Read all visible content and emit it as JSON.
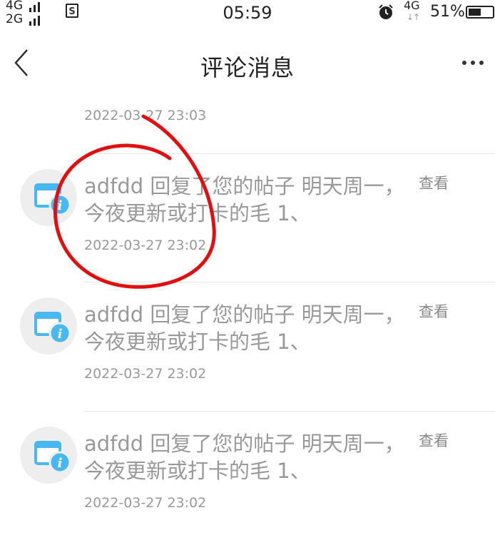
{
  "status_bar": {
    "sig1": "4G",
    "sig2": "2G",
    "time": "05:59",
    "net": "4G",
    "battery": "51%"
  },
  "nav": {
    "title": "评论消息"
  },
  "top_date": "2022-03-27 23:03",
  "messages": [
    {
      "text": "adfdd 回复了您的帖子 明天周一，今夜更新或打卡的毛 1、",
      "time": "2022-03-27 23:02",
      "action": "查看"
    },
    {
      "text": "adfdd 回复了您的帖子 明天周一，今夜更新或打卡的毛 1、",
      "time": "2022-03-27 23:02",
      "action": "查看"
    },
    {
      "text": "adfdd 回复了您的帖子 明天周一，今夜更新或打卡的毛 1、",
      "time": "2022-03-27 23:02",
      "action": "查看"
    }
  ],
  "colors": {
    "text_gray": "#999999",
    "avatar_bg": "#eeeeee",
    "icon_blue": "#4ab8f0",
    "annotation_red": "#e01010"
  }
}
